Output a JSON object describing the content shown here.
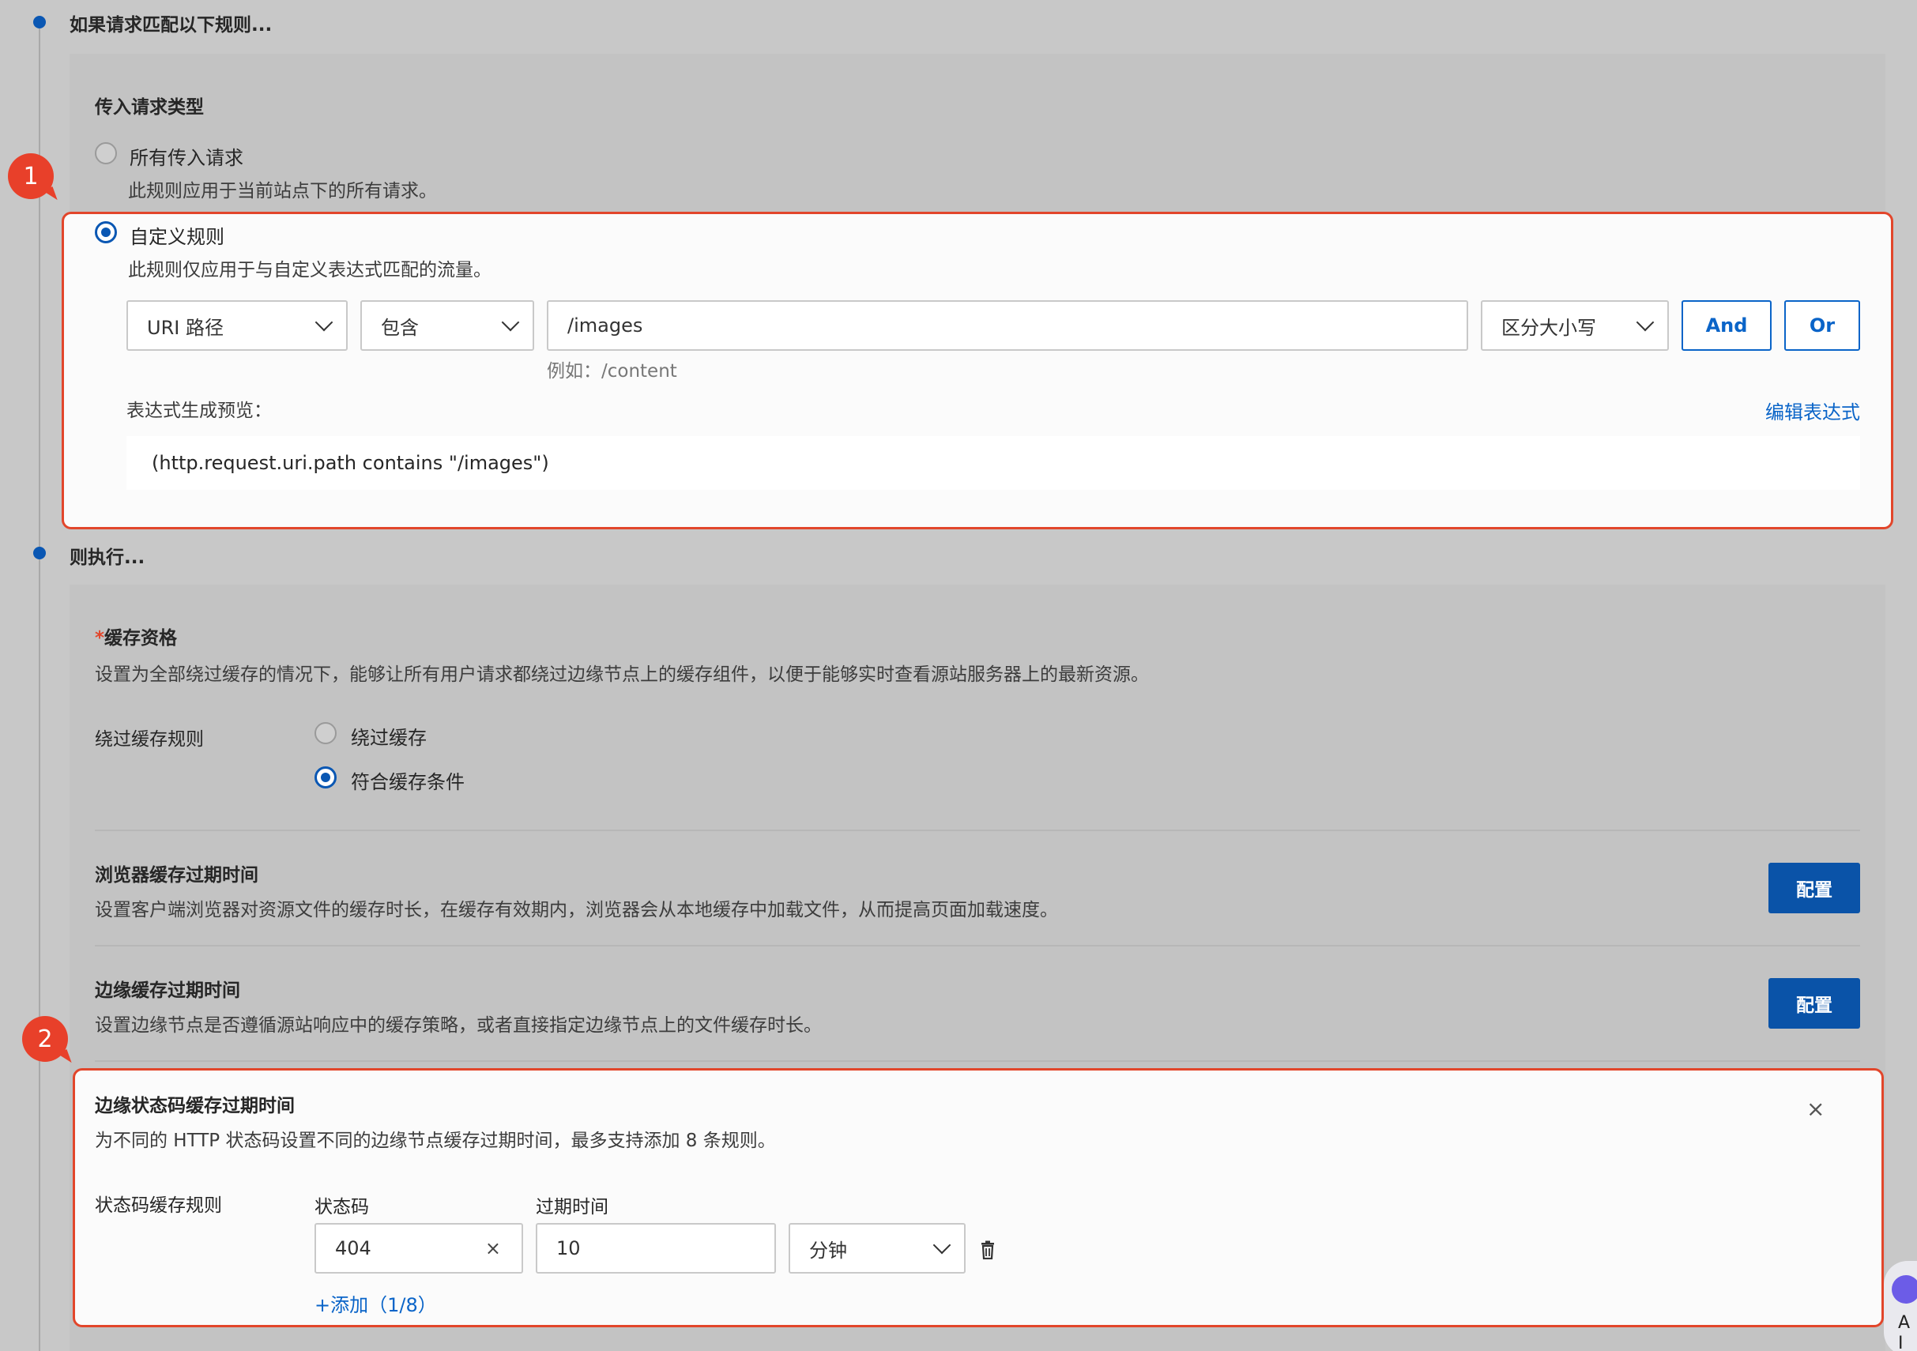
{
  "if_section": {
    "title": "如果请求匹配以下规则...",
    "request_type_title": "传入请求类型",
    "option_all": {
      "label": "所有传入请求",
      "desc": "此规则应用于当前站点下的所有请求。",
      "checked": false
    },
    "option_custom": {
      "label": "自定义规则",
      "desc": "此规则仅应用于与自定义表达式匹配的流量。",
      "checked": true
    },
    "condition": {
      "field": "URI 路径",
      "operator": "包含",
      "value": "/images",
      "value_hint": "例如：/content",
      "case": "区分大小写",
      "and_label": "And",
      "or_label": "Or"
    },
    "preview_label": "表达式生成预览：",
    "edit_expression": "编辑表达式",
    "expression": "(http.request.uri.path contains \"/images\")"
  },
  "then_section": {
    "title": "则执行...",
    "cache_eligibility": {
      "required_mark": "*",
      "title": "缓存资格",
      "desc": "设置为全部绕过缓存的情况下，能够让所有用户请求都绕过边缘节点上的缓存组件，以便于能够实时查看源站服务器上的最新资源。",
      "bypass_rule_label": "绕过缓存规则",
      "option_bypass": {
        "label": "绕过缓存",
        "checked": false
      },
      "option_eligible": {
        "label": "符合缓存条件",
        "checked": true
      }
    },
    "browser_ttl": {
      "title": "浏览器缓存过期时间",
      "desc": "设置客户端浏览器对资源文件的缓存时长，在缓存有效期内，浏览器会从本地缓存中加载文件，从而提高页面加载速度。",
      "button": "配置"
    },
    "edge_ttl": {
      "title": "边缘缓存过期时间",
      "desc": "设置边缘节点是否遵循源站响应中的缓存策略，或者直接指定边缘节点上的文件缓存时长。",
      "button": "配置"
    },
    "status_code_ttl": {
      "title": "边缘状态码缓存过期时间",
      "desc": "为不同的 HTTP 状态码设置不同的边缘节点缓存过期时间，最多支持添加 8 条规则。",
      "rule_label": "状态码缓存规则",
      "col_status": "状态码",
      "col_expire": "过期时间",
      "rows": [
        {
          "status": "404",
          "expire": "10",
          "unit": "分钟"
        }
      ],
      "add_link": "+添加（1/8）"
    }
  },
  "annotations": {
    "badge1": "1",
    "badge2": "2"
  },
  "ai_assistant": {
    "label": "AI 助"
  },
  "colors": {
    "accent": "#0a57b3",
    "highlight": "#e2462b",
    "badge": "#e8402a"
  }
}
